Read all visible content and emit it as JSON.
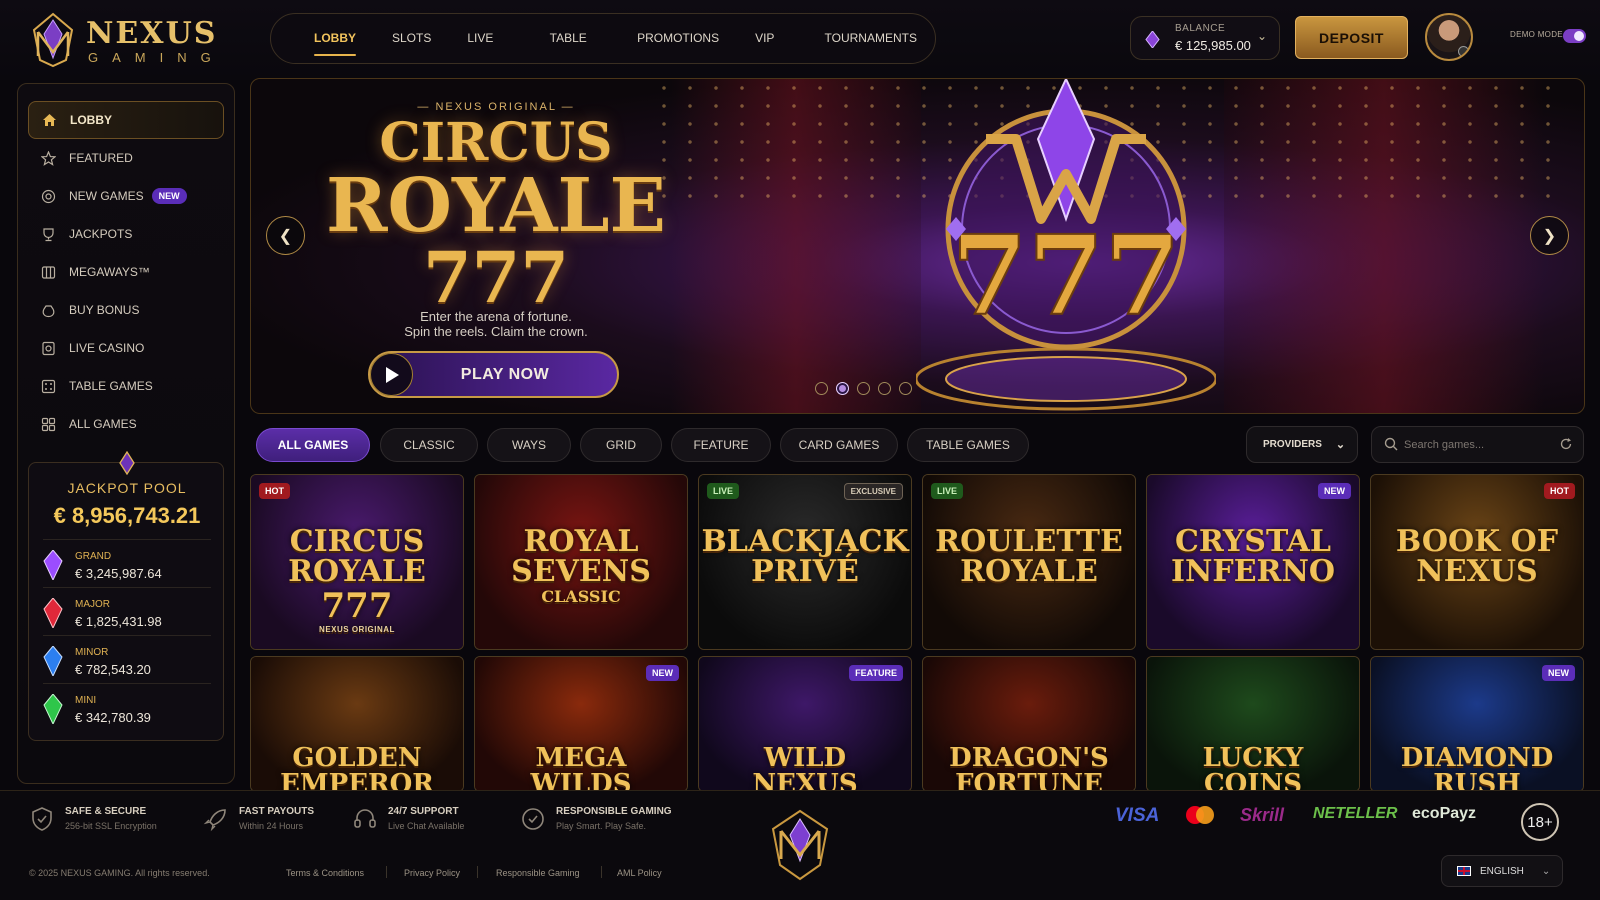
{
  "brand": {
    "name": "NEXUS",
    "sub": "GAMING"
  },
  "nav": [
    {
      "label": "LOBBY",
      "active": true
    },
    {
      "label": "SLOTS"
    },
    {
      "label": "LIVE CASINO"
    },
    {
      "label": "TABLE GAMES"
    },
    {
      "label": "PROMOTIONS"
    },
    {
      "label": "VIP CLUB"
    },
    {
      "label": "TOURNAMENTS"
    }
  ],
  "balance": {
    "label": "BALANCE",
    "value": "€ 125,985.00"
  },
  "deposit_label": "DEPOSIT",
  "demo_mode": {
    "label": "DEMO MODE",
    "on": true
  },
  "sidebar": {
    "items": [
      {
        "label": "LOBBY",
        "icon": "home-icon",
        "active": true
      },
      {
        "label": "FEATURED",
        "icon": "star-icon"
      },
      {
        "label": "NEW GAMES",
        "icon": "new-games-icon",
        "badge": "NEW"
      },
      {
        "label": "JACKPOTS",
        "icon": "trophy-icon"
      },
      {
        "label": "MEGAWAYS™",
        "icon": "megaways-icon"
      },
      {
        "label": "BUY BONUS",
        "icon": "bonus-bag-icon"
      },
      {
        "label": "LIVE CASINO",
        "icon": "live-casino-icon"
      },
      {
        "label": "TABLE GAMES",
        "icon": "table-games-icon"
      },
      {
        "label": "ALL GAMES",
        "icon": "grid-icon"
      }
    ]
  },
  "jackpot": {
    "title": "JACKPOT POOL",
    "total": "€ 8,956,743.21",
    "tiers": [
      {
        "name": "GRAND",
        "value": "€ 3,245,987.64",
        "color": "#9b4dff"
      },
      {
        "name": "MAJOR",
        "value": "€ 1,825,431.98",
        "color": "#e0283a"
      },
      {
        "name": "MINOR",
        "value": "€ 782,543.20",
        "color": "#2c7ff0"
      },
      {
        "name": "MINI",
        "value": "€ 342,780.39",
        "color": "#2ec64a"
      }
    ]
  },
  "hero": {
    "eyebrow": "NEXUS ORIGINAL",
    "title_l1": "CIRCUS",
    "title_l2": "ROYALE",
    "title_l3": "777",
    "tagline_1": "Enter the arena of fortune.",
    "tagline_2": "Spin the reels. Claim the crown.",
    "cta": "PLAY NOW",
    "slides": 5,
    "active_slide": 2
  },
  "filters": [
    {
      "label": "ALL GAMES",
      "active": true
    },
    {
      "label": "CLASSIC"
    },
    {
      "label": "WAYS"
    },
    {
      "label": "GRID"
    },
    {
      "label": "FEATURE"
    },
    {
      "label": "CARD GAMES"
    },
    {
      "label": "TABLE GAMES"
    }
  ],
  "providers_label": "PROVIDERS",
  "search_placeholder": "Search games...",
  "games": [
    {
      "l1": "CIRCUS",
      "l2": "ROYALE",
      "l3": "777",
      "sub": "NEXUS ORIGINAL",
      "badge": "HOT",
      "badge_side": "left",
      "theme": "purple"
    },
    {
      "l1": "ROYAL",
      "l2": "SEVENS",
      "l3": "CLASSIC",
      "badge": "",
      "theme": "red"
    },
    {
      "l1": "BLACKJACK",
      "l2": "PRIVÉ",
      "badge": "LIVE",
      "badge_side": "left",
      "badge2": "EXCLUSIVE",
      "theme": "dark"
    },
    {
      "l1": "ROULETTE",
      "l2": "ROYALE",
      "badge": "LIVE",
      "badge_side": "left",
      "theme": "brown"
    },
    {
      "l1": "CRYSTAL",
      "l2": "INFERNO",
      "badge": "NEW",
      "badge_side": "right",
      "theme": "violet"
    },
    {
      "l1": "BOOK OF",
      "l2": "NEXUS",
      "badge": "HOT",
      "badge_side": "right",
      "theme": "gold"
    },
    {
      "l1": "GOLDEN",
      "l2": "EMPEROR",
      "badge": "",
      "theme": "bronze"
    },
    {
      "l1": "MEGA",
      "l2": "WILDS",
      "badge": "NEW",
      "badge_side": "right",
      "theme": "fire"
    },
    {
      "l1": "WILD",
      "l2": "NEXUS",
      "badge": "FEATURE",
      "badge_side": "right",
      "theme": "purple2"
    },
    {
      "l1": "DRAGON'S",
      "l2": "FORTUNE",
      "badge": "",
      "theme": "ember"
    },
    {
      "l1": "LUCKY",
      "l2": "COINS",
      "badge": "",
      "theme": "green"
    },
    {
      "l1": "DIAMOND",
      "l2": "RUSH",
      "badge": "NEW",
      "badge_side": "right",
      "theme": "blue"
    }
  ],
  "footer": {
    "features": [
      {
        "title": "SAFE & SECURE",
        "sub": "256-bit SSL Encryption",
        "icon": "shield-icon"
      },
      {
        "title": "FAST PAYOUTS",
        "sub": "Within 24 Hours",
        "icon": "rocket-icon"
      },
      {
        "title": "24/7 SUPPORT",
        "sub": "Live Chat Available",
        "icon": "headset-icon"
      },
      {
        "title": "RESPONSIBLE GAMING",
        "sub": "Play Smart. Play Safe.",
        "icon": "responsible-gaming-icon"
      }
    ],
    "payments": [
      "VISA",
      "mastercard",
      "Skrill",
      "NETELLER",
      "ecoPayz"
    ],
    "age": "18+",
    "copyright": "© 2025 NEXUS GAMING. All rights reserved.",
    "links": [
      "Terms & Conditions",
      "Privacy Policy",
      "Responsible Gaming",
      "AML Policy"
    ],
    "language": "ENGLISH"
  },
  "colors": {
    "gold": "#e9c46a",
    "purple": "#5b2ea8",
    "bg": "#09070c"
  }
}
